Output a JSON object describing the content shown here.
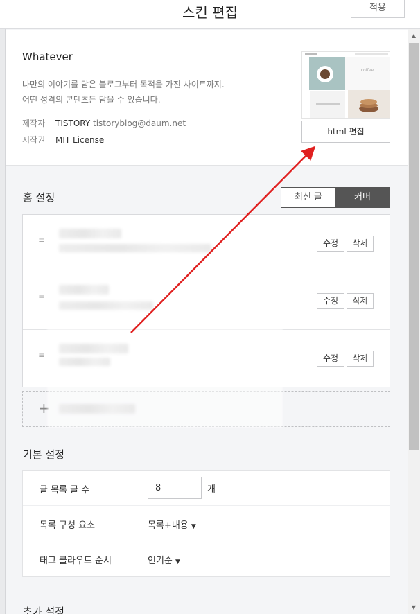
{
  "header": {
    "title": "스킨 편집",
    "apply_label": "적용"
  },
  "skin": {
    "name": "Whatever",
    "desc_line1": "나만의 이야기를 담은 블로그부터 목적을 가진 사이트까지.",
    "desc_line2": "어떤 성격의 콘텐츠든 담을 수 있습니다.",
    "author_label": "제작자",
    "author_name": "TISTORY",
    "author_email": "tistoryblog@daum.net",
    "license_label": "저작권",
    "license_value": "MIT License",
    "thumbnail_caption": "coffee",
    "html_edit_label": "html 편집"
  },
  "home": {
    "title": "홈 설정",
    "toggle_latest": "최신 글",
    "toggle_cover": "커버",
    "items": [
      {
        "edit": "수정",
        "delete": "삭제"
      },
      {
        "edit": "수정",
        "delete": "삭제"
      },
      {
        "edit": "수정",
        "delete": "삭제"
      }
    ],
    "add_label": "+"
  },
  "basic": {
    "title": "기본 설정",
    "post_count_label": "글 목록 글 수",
    "post_count_value": "8",
    "post_count_unit": "개",
    "list_elements_label": "목록 구성 요소",
    "list_elements_value": "목록+내용",
    "tag_cloud_label": "태그 클라우드 순서",
    "tag_cloud_value": "인기순"
  },
  "extra": {
    "title": "추가 설정"
  },
  "icons": {
    "drag": "drag-handle-icon",
    "dropdown": "caret-down-icon",
    "arrow_up": "scroll-up-icon",
    "arrow_down": "scroll-down-icon"
  },
  "colors": {
    "accent_dark": "#555555",
    "annotation_arrow": "#e02020"
  }
}
